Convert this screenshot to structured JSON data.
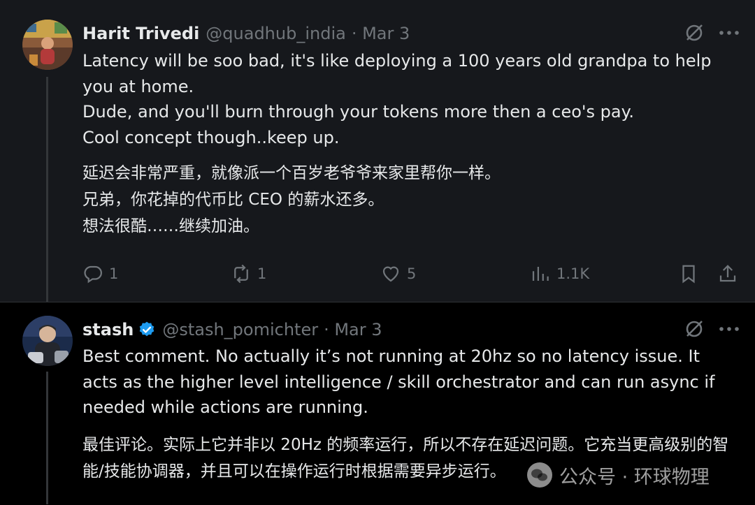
{
  "colors": {
    "background": "#000000",
    "highlight_background": "#16181c",
    "text": "#e7e9ea",
    "muted": "#71767b",
    "verified_blue": "#1d9bf0"
  },
  "tweets": [
    {
      "name": "Harit Trivedi",
      "handle": "@quadhub_india",
      "date": "· Mar 3",
      "verified": false,
      "text_en": [
        "Latency will be soo bad, it's like deploying a 100 years old grandpa to help you at home.",
        "Dude, and you'll burn through your tokens more then a ceo's pay.",
        "Cool concept though..keep up."
      ],
      "text_zh": [
        "延迟会非常严重，就像派一个百岁老爷爷来家里帮你一样。",
        "兄弟，你花掉的代币比 CEO 的薪水还多。",
        "想法很酷……继续加油。"
      ],
      "actions": {
        "reply": {
          "icon": "reply-icon",
          "count": "1"
        },
        "retweet": {
          "icon": "retweet-icon",
          "count": "1"
        },
        "like": {
          "icon": "heart-icon",
          "count": "5"
        },
        "views": {
          "icon": "analytics-icon",
          "count": "1.1K"
        },
        "bookmark": {
          "icon": "bookmark-icon"
        },
        "share": {
          "icon": "share-icon"
        }
      }
    },
    {
      "name": "stash",
      "handle": "@stash_pomichter",
      "date": "· Mar 3",
      "verified": true,
      "text_en": [
        "Best comment. No actually it’s not running at 20hz so no latency issue. It acts as the higher level intelligence / skill orchestrator and can run async if needed while actions are running."
      ],
      "text_zh": [
        "最佳评论。实际上它并非以 20Hz 的频率运行，所以不存在延迟问题。它充当更高级别的智能/技能协调器，并且可以在操作运行时根据需要异步运行。"
      ]
    }
  ],
  "watermark": {
    "text": "公众号 · 环球物理",
    "icon": "wechat-icon"
  }
}
